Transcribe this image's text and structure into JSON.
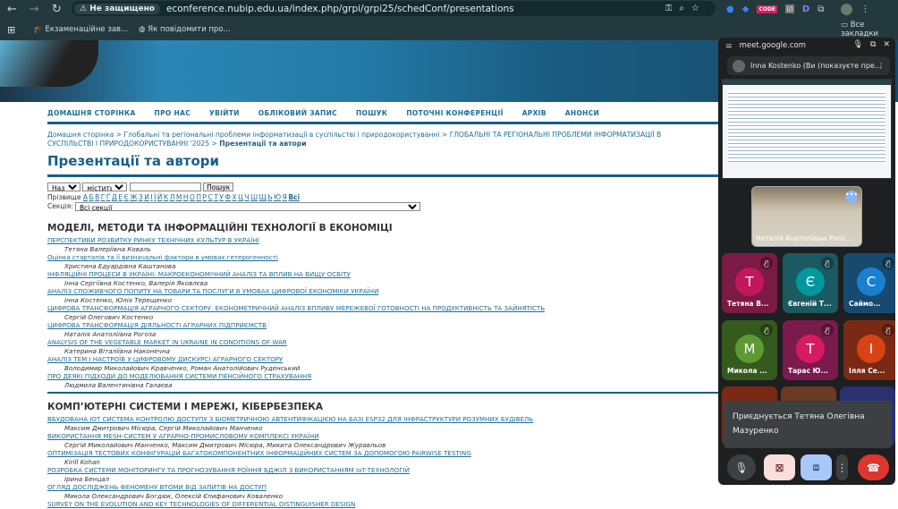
{
  "browser": {
    "security": "Не защищено",
    "url": "econference.nubip.edu.ua/index.php/grpi/grpi25/schedConf/presentations",
    "bookmarks": [
      "Екзаменаційне зав...",
      "Як повідомити про..."
    ],
    "all_bookmarks": "Все закладки",
    "ext_code": "CODE",
    "ext_d": "D"
  },
  "nav": [
    "ДОМАШНЯ СТОРІНКА",
    "ПРО НАС",
    "УВІЙТИ",
    "ОБЛІКОВИЙ ЗАПИС",
    "ПОШУК",
    "ПОТОЧНІ КОНФЕРЕНЦІЇ",
    "АРХІВ",
    "АНОНСИ"
  ],
  "breadcrumb": {
    "home": "Домашня сторінка",
    "conf": "Глобальні та регіональні проблеми інформатизації в суспільстві і природокористуванні",
    "sched": "ГЛОБАЛЬНІ ТА РЕГІОНАЛЬНІ ПРОБЛЕМИ ІНФОРМАТИЗАЦІЇ В СУСПІЛЬСТВІ І ПРИРОДОКОРИСТУВАННІ '2025",
    "current": "Презентації та автори",
    "sep": " > "
  },
  "title": "Презентації та автори",
  "search": {
    "field": "Назва",
    "op": "містить",
    "value": "",
    "button": "Пошук",
    "surname_label": "Прізвище",
    "letters": [
      "А",
      "Б",
      "В",
      "Г",
      "Ґ",
      "Д",
      "Е",
      "Є",
      "Ж",
      "З",
      "И",
      "І",
      "Ї",
      "Й",
      "К",
      "Л",
      "М",
      "Н",
      "О",
      "П",
      "Р",
      "С",
      "Т",
      "У",
      "Ф",
      "Х",
      "Ц",
      "Ч",
      "Ш",
      "Щ",
      "Ь",
      "Ю",
      "Я"
    ],
    "all": "Всі",
    "section_label": "Секція:",
    "section": "Всі секції"
  },
  "sections": [
    {
      "title": "МОДЕЛІ, МЕТОДИ ТА ІНФОРМАЦІЙНІ ТЕХНОЛОГІЇ В ЕКОНОМІЦІ",
      "items": [
        {
          "t": "ПЕРСПЕКТИВИ РОЗВИТКУ РИНКУ ТЕХНІЧНИХ КУЛЬТУР В УКРАЇНІ",
          "a": "Тетяна Валеріївна Коваль"
        },
        {
          "t": "Оцінка стартапів та її визначальні фактори в умовах гетерогенності",
          "a": "Христина Едуардівна Каштанова"
        },
        {
          "t": "ІНФЛЯЦІЙНІ ПРОЦЕСИ В УКРАЇНІ: МАКРОЕКОНОМІЧНИЙ АНАЛІЗ ТА ВПЛИВ НА ВИЩУ ОСВІТУ",
          "a": "Інна Сергіївна Костенко, Валерія Яковлєва"
        },
        {
          "t": "АНАЛІЗ СПОЖИВЧОГО ПОПИТУ НА ТОВАРИ ТА ПОСЛУГИ В УМОВАХ ЦИФРОВОЇ ЕКОНОМІКИ УКРАЇНИ",
          "a": "Інна Костенко, Юлія Терещенко"
        },
        {
          "t": "ЦИФРОВА ТРАНСФОРМАЦІЯ АГРАРНОГО СЕКТОРУ: ЕКОНОМЕТРИЧНИЙ АНАЛІЗ ВПЛИВУ МЕРЕЖЕВОЇ ГОТОВНОСТІ НА ПРОДУКТИВНІСТЬ ТА ЗАЙНЯТІСТЬ",
          "a": "Сергій Олегович Костенко"
        },
        {
          "t": "ЦИФРОВА ТРАНСФОРМАЦІЯ ДІЯЛЬНОСТІ АГРАРНИХ ПІДПРИЄМСТВ",
          "a": "Наталія Анатоліївна Рогоза"
        },
        {
          "t": "ANALYSIS OF THE VEGETABLE MARKET IN UKRAINE IN CONDITIONS OF WAR",
          "a": "Катерина Віталіївна Наконечна"
        },
        {
          "t": "АНАЛІЗ ТЕМ І НАСТРОЇВ У ЦИФРОВОМУ ДИСКУРСІ АГРАРНОГО СЕКТОРУ",
          "a": "Володимир Миколайович Кравченко, Роман Анатолійович Руденський"
        },
        {
          "t": "ПРО ДЕЯКІ ПІДХОДИ ДО МОДЕЛЮВАННЯ СИСТЕМИ ПЕНСІЙНОГО СТРАХУВАННЯ",
          "a": "Людмила Валентинівна Галаєва"
        }
      ]
    },
    {
      "title": "КОМП’ЮТЕРНІ СИСТЕМИ І МЕРЕЖІ, КІБЕРБЕЗПЕКА",
      "items": [
        {
          "t": "ВБУДОВАНА IOT СИСТЕМА КОНТРОЛЮ ДОСТУПУ З БІОМЕТРИЧНОЮ АВТЕНТИФІКАЦІЄЮ НА БАЗІ ESP32 ДЛЯ ІНФРАСТРУКТУРИ РОЗУМНИХ БУДІВЕЛЬ",
          "a": "Максим Дмитрович Місюра, Сергій Миколайович Манченко"
        },
        {
          "t": "ВИКОРИСТАННЯ MESH-СИСТЕМ У АГРАРНО-ПРОМИСЛОВОМУ КОМПЛЕКСІ УКРАЇНИ",
          "a": "Сергій Миколайович Манченко, Максим Дмитрович Місюра, Микита Олександрович Журавльов"
        },
        {
          "t": "ОПТИМІЗАЦІЯ ТЕСТОВИХ КОНФІГУРАЦІЙ БАГАТОКОМПОНЕНТНИХ ІНФОРМАЦІЙНИХ СИСТЕМ ЗА ДОПОМОГОЮ PAIRWISE TESTING",
          "a": "Kirill Kohan"
        },
        {
          "t": "РОЗРОБКА СИСТЕМИ МОНІТОРИНГУ ТА ПРОГНОЗУВАННЯ РОЇННЯ БДЖІЛ З ВИКОРИСТАННЯМ IoT-ТЕХНОЛОГІЙ",
          "a": "Ірина Бенцал"
        },
        {
          "t": "ОГЛЯД ДОСЛІДЖЕНЬ ФЕНОМЕНУ ВТОМИ ВІД ЗАПИТІВ НА ДОСТУП",
          "a": "Микола Олександрович Богдюк, Олексій Єпифанович Коваленко"
        },
        {
          "t": "SURVEY ON THE EVOLUTION AND KEY TECHNOLOGIES OF DIFFERENTIAL DISTINGUISHER DESIGN",
          "a": ""
        }
      ]
    }
  ],
  "meet": {
    "site": "meet.google.com",
    "presenter": "Inna Kostenko (Ви (показуєте пре...",
    "self_name": "Наталія Анатоліївна Рого...",
    "tiles": [
      {
        "i": "Т",
        "n": "Тетяна В...",
        "bg": "#7a1a45",
        "c": "#c2185b"
      },
      {
        "i": "Є",
        "n": "Євгеній Т...",
        "bg": "#1a5a60",
        "c": "#00979d"
      },
      {
        "i": "С",
        "n": "Саймо...",
        "bg": "#174a6e",
        "c": "#1a7fd0"
      },
      {
        "i": "М",
        "n": "Микола ...",
        "bg": "#355a1e",
        "c": "#5e9a33"
      },
      {
        "i": "Т",
        "n": "Тарас Ю...",
        "bg": "#7a1a4d",
        "c": "#d81b60"
      },
      {
        "i": "І",
        "n": "Ілля Се...",
        "bg": "#7a2a14",
        "c": "#d84315"
      }
    ],
    "toast": "Приєднується Тетяна Олегівна Мазуренко"
  }
}
